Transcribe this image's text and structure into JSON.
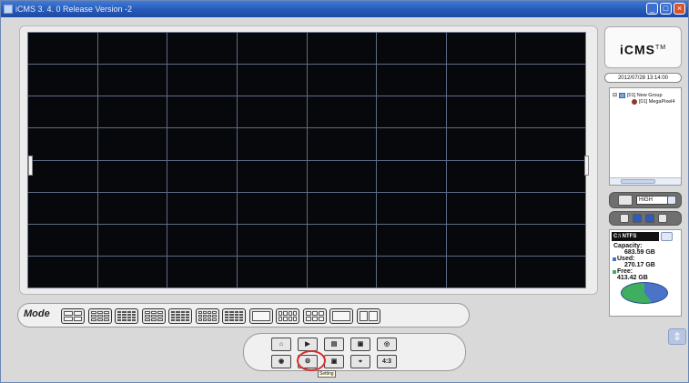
{
  "window": {
    "title": "iCMS 3. 4. 0 Release Version -2",
    "buttons": [
      "minimize",
      "maximize",
      "close"
    ]
  },
  "video_grid": {
    "rows": 8,
    "columns": 8
  },
  "sidebar": {
    "logo": "iCMS",
    "logo_mark": "TM",
    "datetime": "2012/07/28 13:14:00",
    "tree": {
      "group": "[01] New Group",
      "device": "[01] MegaPixel4"
    },
    "quality_select": "HIGH",
    "disk": {
      "drive": "C:\\ NTFS",
      "capacity_label": "Capacity:",
      "capacity_value": "683.59 GB",
      "used_label": "Used:",
      "used_value": "270.17 GB",
      "free_label": "Free:",
      "free_value": "413.42 GB",
      "used_fraction": 0.395,
      "colors": {
        "used": "#4b73c7",
        "free": "#3fae5e"
      }
    }
  },
  "mode_bar": {
    "label": "Mode",
    "buttons": [
      {
        "name": "layout-2x2",
        "cols": 2,
        "rows": 2
      },
      {
        "name": "layout-3x3",
        "cols": 3,
        "rows": 3
      },
      {
        "name": "layout-4x4",
        "cols": 4,
        "rows": 4
      },
      {
        "name": "layout-1plus5",
        "cols": 3,
        "rows": 3
      },
      {
        "name": "layout-1plus7",
        "cols": 4,
        "rows": 4
      },
      {
        "name": "layout-1plus9",
        "cols": 4,
        "rows": 3
      },
      {
        "name": "layout-1plus12",
        "cols": 4,
        "rows": 4
      },
      {
        "name": "layout-single",
        "cols": 1,
        "rows": 1
      },
      {
        "name": "layout-2x4",
        "cols": 4,
        "rows": 2
      },
      {
        "name": "layout-custom",
        "cols": 3,
        "rows": 2
      },
      {
        "name": "layout-fullscreen",
        "cols": 1,
        "rows": 1
      },
      {
        "name": "layout-sequence",
        "cols": 2,
        "rows": 1
      }
    ]
  },
  "control_bar": {
    "buttons": [
      {
        "name": "snapshot-icon",
        "label": "⌂"
      },
      {
        "name": "play-icon",
        "label": "▶"
      },
      {
        "name": "playback-icon",
        "label": "▤"
      },
      {
        "name": "camera-add-icon",
        "label": "▣"
      },
      {
        "name": "network-icon",
        "label": "◎"
      },
      {
        "name": "record-icon",
        "label": "◉"
      },
      {
        "name": "setting-icon",
        "label": "⚙"
      },
      {
        "name": "camera-config-icon",
        "label": "▣"
      },
      {
        "name": "lock-icon",
        "label": "⌖"
      },
      {
        "name": "aspect-ratio",
        "label": "4:3"
      }
    ],
    "tooltip": "Setting"
  }
}
